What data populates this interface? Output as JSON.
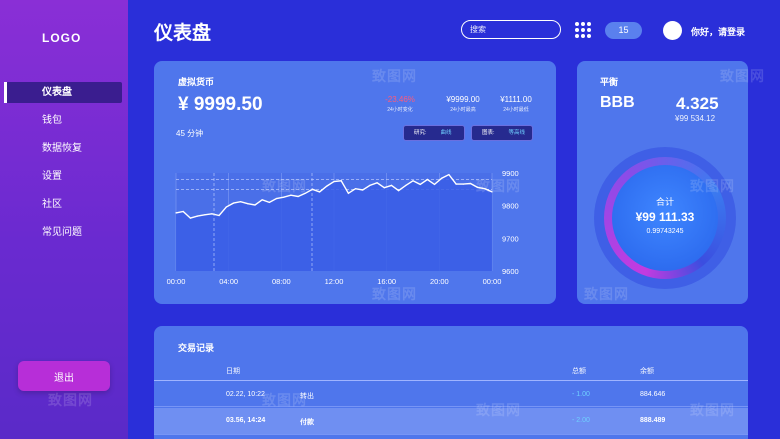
{
  "sidebar": {
    "logo": "LOGO",
    "items": [
      {
        "label": "仪表盘"
      },
      {
        "label": "钱包"
      },
      {
        "label": "数据恢复"
      },
      {
        "label": "设置"
      },
      {
        "label": "社区"
      },
      {
        "label": "常见问题"
      }
    ],
    "logout_label": "退出"
  },
  "header": {
    "title": "仪表盘",
    "search_placeholder": "搜索",
    "badge": "15",
    "greeting": "你好，请登录"
  },
  "crypto": {
    "title": "虚拟货币",
    "price": "¥ 9999.50",
    "change_value": "-23.46%",
    "change_label": "24小时变化",
    "high_value": "¥9999.00",
    "high_label": "24小时最高",
    "low_value": "¥1111.00",
    "low_label": "24小时最低",
    "interval": "45 分钟",
    "study_label": "研究:",
    "study_value": "曲线",
    "chart_label": "图表:",
    "chart_value": "等高线"
  },
  "chart_data": {
    "type": "area",
    "x_ticks": [
      "00:00",
      "04:00",
      "08:00",
      "12:00",
      "16:00",
      "20:00",
      "00:00"
    ],
    "y_ticks": [
      9900,
      9800,
      9700,
      9600
    ],
    "ylim": [
      9600,
      9900
    ],
    "values": [
      9778,
      9782,
      9762,
      9768,
      9772,
      9775,
      9770,
      9796,
      9808,
      9812,
      9806,
      9802,
      9818,
      9810,
      9822,
      9826,
      9832,
      9828,
      9838,
      9850,
      9842,
      9860,
      9874,
      9876,
      9838,
      9852,
      9848,
      9862,
      9870,
      9855,
      9862,
      9846,
      9862,
      9876,
      9865,
      9880,
      9865,
      9884,
      9895,
      9866,
      9866,
      9868,
      9856,
      9852,
      9842
    ],
    "grid": true
  },
  "balance": {
    "title": "平衡",
    "coin": "BBB",
    "amount": "4.325",
    "amount_cny": "¥99 534.12",
    "total_label": "合计",
    "total_value": "¥99 111.33",
    "total_sub": "0.99743245"
  },
  "transactions": {
    "title": "交易记录",
    "headers": {
      "date": "日期",
      "total": "总额",
      "balance": "余额"
    },
    "rows": [
      {
        "date": "02.22, 10:22",
        "type": "转出",
        "total": "- 1.00",
        "balance": "884.646"
      },
      {
        "date": "03.56, 14:24",
        "type": "付款",
        "total": "- 2.00",
        "balance": "888.489"
      }
    ]
  },
  "watermark": "致图网"
}
